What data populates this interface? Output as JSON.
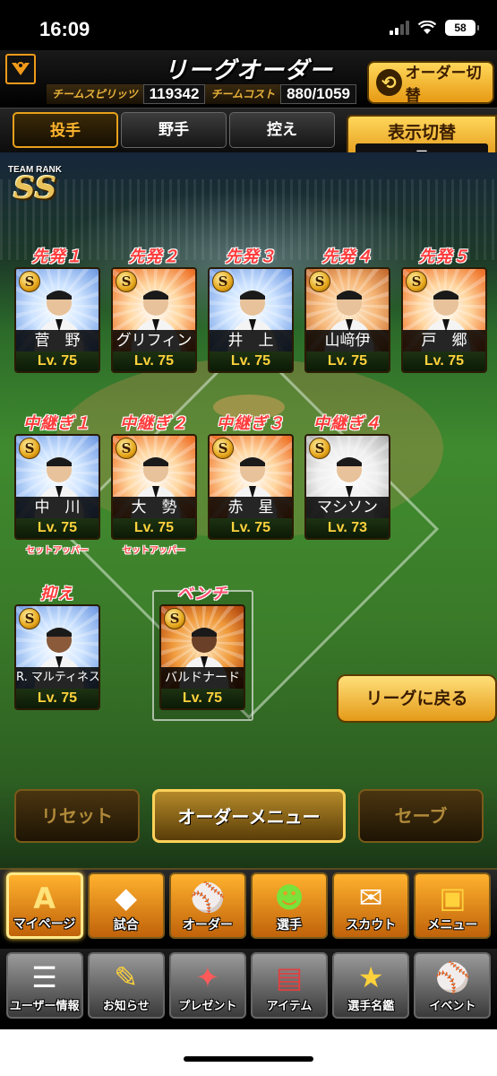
{
  "status_bar": {
    "time": "16:09",
    "battery": "58",
    "icons": [
      "signal-icon",
      "wifi-icon",
      "battery-icon"
    ]
  },
  "header": {
    "title": "リーグオーダー",
    "team_spirit_label": "チームスピリッツ",
    "team_spirit_value": "119342",
    "team_cost_label": "チームコスト",
    "team_cost_value": "880/1059",
    "order_switch_label": "オーダー切替"
  },
  "tabs": [
    {
      "label": "投手",
      "active": true
    },
    {
      "label": "野手",
      "active": false
    },
    {
      "label": "控え",
      "active": false
    }
  ],
  "display_switch": {
    "label": "表示切替",
    "value": "ー"
  },
  "team_rank": {
    "label": "TEAM RANK",
    "value": "SS"
  },
  "starters": [
    {
      "role": "先発１",
      "name": "菅　野",
      "level": "Lv. 75",
      "grade": "S",
      "theme": "blue"
    },
    {
      "role": "先発２",
      "name": "グリフィン",
      "level": "Lv. 75",
      "grade": "S",
      "theme": "orange"
    },
    {
      "role": "先発３",
      "name": "井　上",
      "level": "Lv. 75",
      "grade": "S",
      "theme": "blue"
    },
    {
      "role": "先発４",
      "name": "山﨑伊",
      "level": "Lv. 75",
      "grade": "S",
      "theme": "warm"
    },
    {
      "role": "先発５",
      "name": "戸　郷",
      "level": "Lv. 75",
      "grade": "S",
      "theme": "orange"
    }
  ],
  "relievers": [
    {
      "role": "中継ぎ１",
      "name": "中　川",
      "level": "Lv. 75",
      "grade": "S",
      "theme": "blue",
      "sub_role": "セットアッパー"
    },
    {
      "role": "中継ぎ２",
      "name": "大　勢",
      "level": "Lv. 75",
      "grade": "S",
      "theme": "orange",
      "sub_role": "セットアッパー"
    },
    {
      "role": "中継ぎ３",
      "name": "赤　星",
      "level": "Lv. 75",
      "grade": "S",
      "theme": "orange",
      "sub_role": ""
    },
    {
      "role": "中継ぎ４",
      "name": "マシソン",
      "level": "Lv. 73",
      "grade": "S",
      "theme": "silver",
      "sub_role": ""
    }
  ],
  "closer": {
    "role": "抑え",
    "name": "R. マルティネス",
    "level": "Lv. 75",
    "grade": "S",
    "theme": "blue"
  },
  "bench": {
    "role": "ベンチ",
    "name": "バルドナード",
    "level": "Lv. 75",
    "grade": "S",
    "theme": "deep"
  },
  "league_back_label": "リーグに戻る",
  "actions": {
    "reset": "リセット",
    "order_menu": "オーダーメニュー",
    "save": "セーブ"
  },
  "nav_main": [
    {
      "label": "マイページ",
      "icon": "home-icon",
      "glyph": "A",
      "active": true
    },
    {
      "label": "試合",
      "icon": "stadium-icon",
      "glyph": "◆",
      "active": false
    },
    {
      "label": "オーダー",
      "icon": "order-icon",
      "glyph": "⚾",
      "active": false
    },
    {
      "label": "選手",
      "icon": "player-icon",
      "glyph": "☻",
      "active": false
    },
    {
      "label": "スカウト",
      "icon": "scout-icon",
      "glyph": "✉",
      "active": false
    },
    {
      "label": "メニュー",
      "icon": "menu-icon",
      "glyph": "▣",
      "active": false
    }
  ],
  "nav_sub": [
    {
      "label": "ユーザー情報",
      "icon": "user-info-icon",
      "glyph": "☰"
    },
    {
      "label": "お知らせ",
      "icon": "notice-icon",
      "glyph": "✎"
    },
    {
      "label": "プレゼント",
      "icon": "present-icon",
      "glyph": "✦"
    },
    {
      "label": "アイテム",
      "icon": "item-icon",
      "glyph": "▤"
    },
    {
      "label": "選手名鑑",
      "icon": "directory-icon",
      "glyph": "★"
    },
    {
      "label": "イベント",
      "icon": "event-icon",
      "glyph": "⚾"
    }
  ],
  "colors": {
    "accent_gold": "#e8a01a",
    "role_red": "#ff3b3b",
    "level_yellow": "#ffd23c"
  }
}
